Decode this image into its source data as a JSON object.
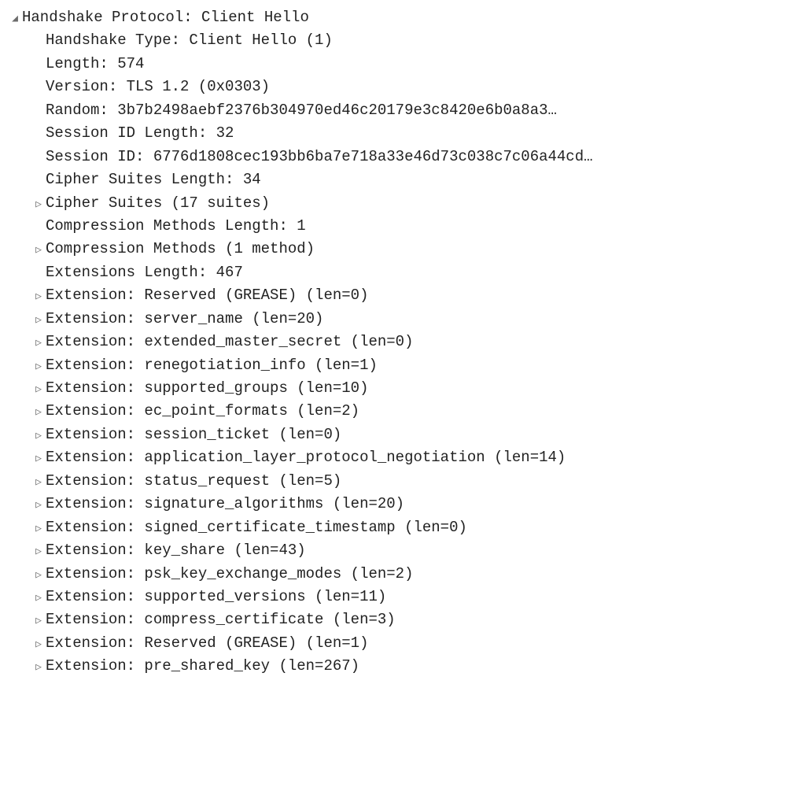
{
  "root": {
    "label": "Handshake Protocol: Client Hello",
    "children": [
      {
        "expandable": false,
        "label": "Handshake Type: Client Hello (1)"
      },
      {
        "expandable": false,
        "label": "Length: 574"
      },
      {
        "expandable": false,
        "label": "Version: TLS 1.2 (0x0303)"
      },
      {
        "expandable": false,
        "label": "Random: 3b7b2498aebf2376b304970ed46c20179e3c8420e6b0a8a3…"
      },
      {
        "expandable": false,
        "label": "Session ID Length: 32"
      },
      {
        "expandable": false,
        "label": "Session ID: 6776d1808cec193bb6ba7e718a33e46d73c038c7c06a44cd…"
      },
      {
        "expandable": false,
        "label": "Cipher Suites Length: 34"
      },
      {
        "expandable": true,
        "label": "Cipher Suites (17 suites)"
      },
      {
        "expandable": false,
        "label": "Compression Methods Length: 1"
      },
      {
        "expandable": true,
        "label": "Compression Methods (1 method)"
      },
      {
        "expandable": false,
        "label": "Extensions Length: 467"
      },
      {
        "expandable": true,
        "label": "Extension: Reserved (GREASE) (len=0)"
      },
      {
        "expandable": true,
        "label": "Extension: server_name (len=20)"
      },
      {
        "expandable": true,
        "label": "Extension: extended_master_secret (len=0)"
      },
      {
        "expandable": true,
        "label": "Extension: renegotiation_info (len=1)"
      },
      {
        "expandable": true,
        "label": "Extension: supported_groups (len=10)"
      },
      {
        "expandable": true,
        "label": "Extension: ec_point_formats (len=2)"
      },
      {
        "expandable": true,
        "label": "Extension: session_ticket (len=0)"
      },
      {
        "expandable": true,
        "label": "Extension: application_layer_protocol_negotiation (len=14)"
      },
      {
        "expandable": true,
        "label": "Extension: status_request (len=5)"
      },
      {
        "expandable": true,
        "label": "Extension: signature_algorithms (len=20)"
      },
      {
        "expandable": true,
        "label": "Extension: signed_certificate_timestamp (len=0)"
      },
      {
        "expandable": true,
        "label": "Extension: key_share (len=43)"
      },
      {
        "expandable": true,
        "label": "Extension: psk_key_exchange_modes (len=2)"
      },
      {
        "expandable": true,
        "label": "Extension: supported_versions (len=11)"
      },
      {
        "expandable": true,
        "label": "Extension: compress_certificate (len=3)"
      },
      {
        "expandable": true,
        "label": "Extension: Reserved (GREASE) (len=1)"
      },
      {
        "expandable": true,
        "label": "Extension: pre_shared_key (len=267)"
      }
    ]
  },
  "glyphs": {
    "expanded": "◢",
    "collapsed": "▷"
  }
}
